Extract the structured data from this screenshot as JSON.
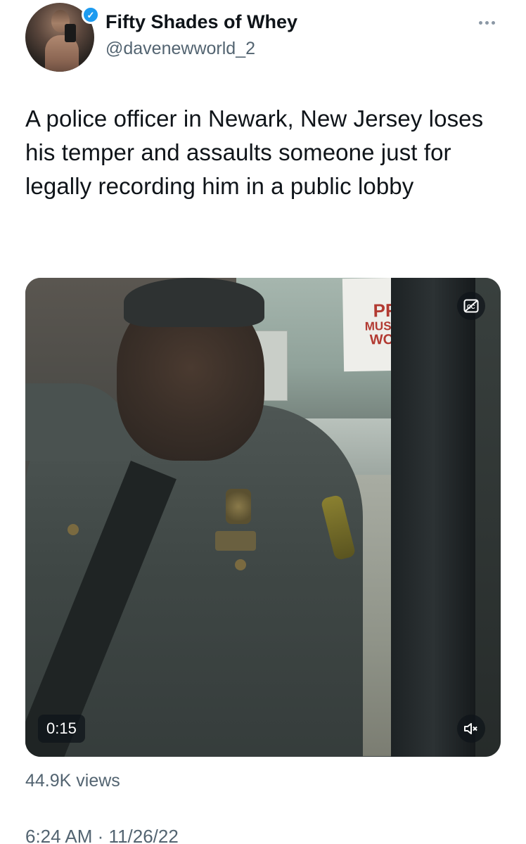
{
  "author": {
    "display_name": "Fifty Shades of Whey",
    "handle": "@davenewworld_2",
    "verified": true
  },
  "tweet": {
    "text": "A police officer in Newark, New Jersey loses his temper and assaults someone just for legally recording him in a public lobby"
  },
  "video": {
    "sign_lines": [
      "PPE",
      "MUST BE",
      "WORN"
    ],
    "duration": "0:15",
    "captions_icon": "captions-icon",
    "mute_icon": "speaker-muted-icon"
  },
  "stats": {
    "views": "44.9K views"
  },
  "meta": {
    "time": "6:24 AM",
    "separator": "·",
    "date": "11/26/22"
  },
  "colors": {
    "text_primary": "#0f1419",
    "text_secondary": "#536471",
    "verified_blue": "#1d9bf0"
  }
}
